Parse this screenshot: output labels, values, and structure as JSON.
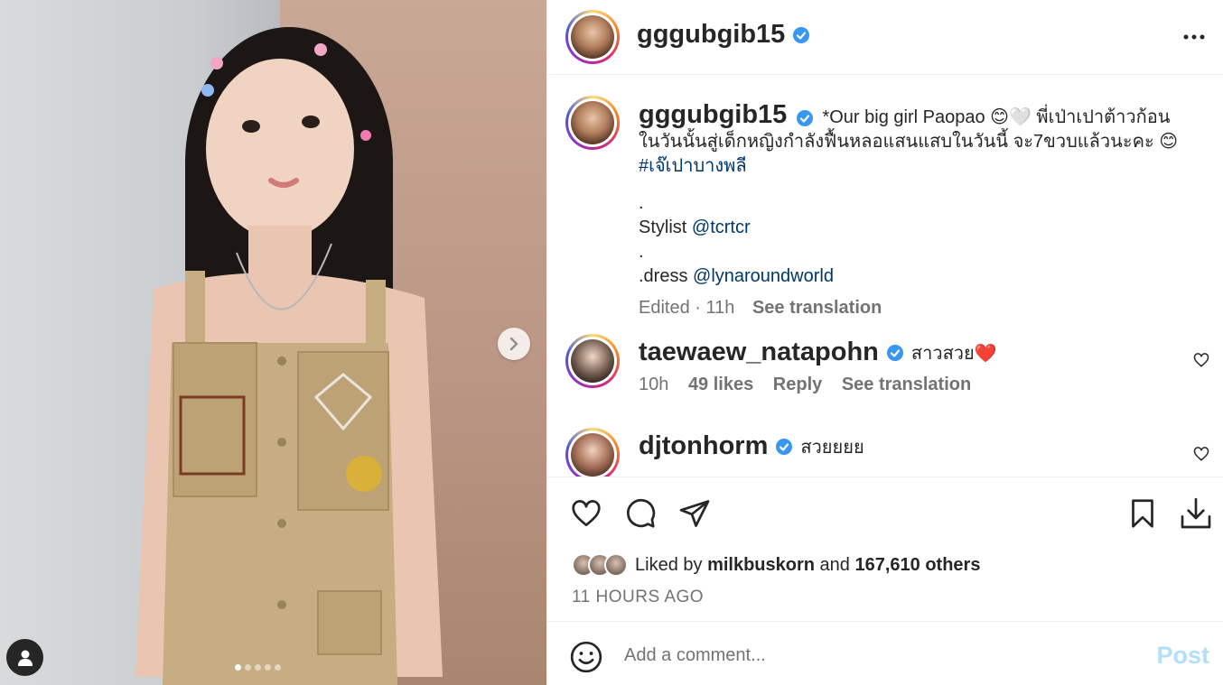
{
  "media": {
    "carousel_total": 5,
    "carousel_active": 1
  },
  "header": {
    "username": "gggubgib15",
    "verified": true
  },
  "caption": {
    "username": "gggubgib15",
    "line1": "*Our big girl Paopao 😊🤍 พี่เป่าเปาต้าวก้อนในวันนั้นสู่เด็กหญิงกำลังฟื้นหลอแสนแสบในวันนี้ จะ7ขวบแล้วนะคะ 😊 ",
    "hashtag": "#เจ๊เปาบางพลี",
    "dot1": ".",
    "stylist_prefix": "Stylist ",
    "stylist_handle": "@tcrtcr",
    "dot2": ".",
    "dress_prefix": ".dress ",
    "dress_handle": "@lynaroundworld",
    "edited": "Edited · 11h",
    "see_translation": "See translation"
  },
  "comments": [
    {
      "username": "taewaew_natapohn",
      "text": "สาวสวย❤️",
      "time": "10h",
      "likes": "49 likes",
      "reply": "Reply",
      "see_translation": "See translation"
    },
    {
      "username": "djtonhorm",
      "text": "สวยยยย"
    }
  ],
  "likes": {
    "prefix": "Liked by ",
    "user": "milkbuskorn",
    "mid": " and ",
    "others": "167,610 others"
  },
  "timeago": "11 HOURS AGO",
  "add_comment": {
    "placeholder": "Add a comment...",
    "post_label": "Post"
  },
  "colors": {
    "verified": "#3897f0",
    "link": "#00376b",
    "post_disabled": "#b2dffc"
  }
}
